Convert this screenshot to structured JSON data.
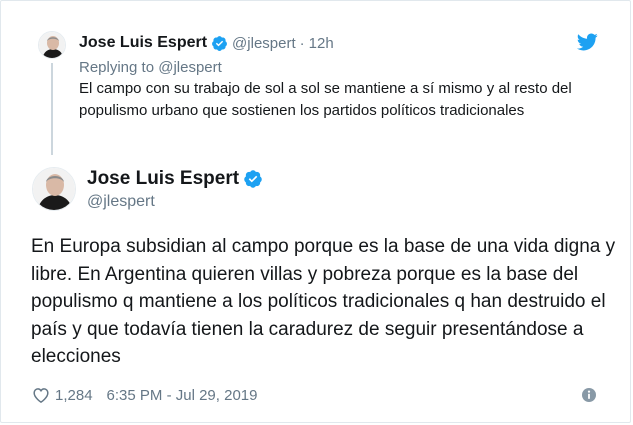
{
  "colors": {
    "twitter_blue": "#1da1f2",
    "text_primary": "#14171a",
    "text_secondary": "#657786",
    "border": "#e1e8ed"
  },
  "parent_tweet": {
    "name": "Jose Luis Espert",
    "handle": "@jlespert",
    "separator": "·",
    "time": "12h",
    "replying_to": "Replying to @jlespert",
    "text": "El campo con su trabajo de sol a sol se mantiene a sí mismo y al resto del populismo urbano que sostienen los partidos políticos tradicionales",
    "icons": [
      "verified-badge-icon",
      "twitter-bird-icon"
    ]
  },
  "main_tweet": {
    "name": "Jose Luis Espert",
    "handle": "@jlespert",
    "text": "En Europa subsidian al campo porque es la base de una vida digna y libre. En Argentina quieren villas y pobreza porque es la base del populismo q mantiene a los políticos tradicionales q han destruido el país y que todavía tienen la caradurez de seguir presentándose a elecciones",
    "likes": "1,284",
    "timestamp": "6:35 PM - Jul 29, 2019",
    "icons": [
      "verified-badge-icon",
      "heart-icon",
      "info-icon"
    ]
  }
}
